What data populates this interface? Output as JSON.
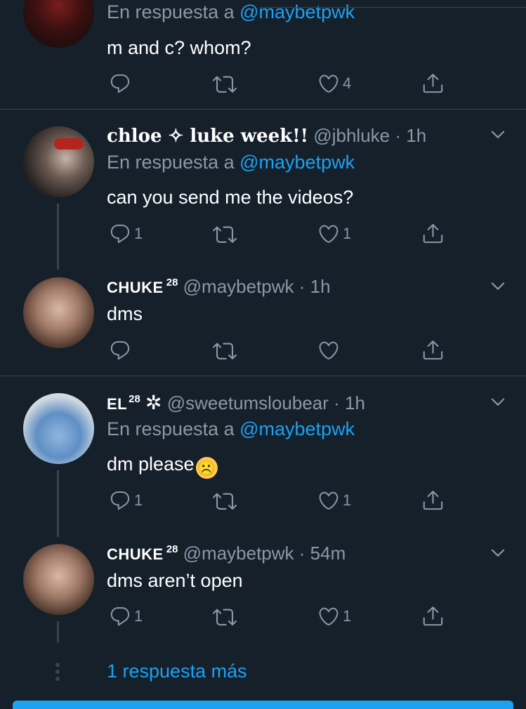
{
  "top_tweet": {
    "reply_prefix": "En respuesta a ",
    "reply_handle": "@maybetpwk",
    "text": "m and c? whom?",
    "like_count": "4"
  },
  "tweet1": {
    "display_name": "chloe ✧ luke week!!",
    "handle": "@jbhluke",
    "time": "· 1h",
    "reply_prefix": "En respuesta a ",
    "reply_handle": "@maybetpwk",
    "text": "can you send me the videos?",
    "reply_count": "1",
    "like_count": "1"
  },
  "tweet2": {
    "display_name": "CHUKE",
    "superscript": "28",
    "handle": "@maybetpwk",
    "time": "· 1h",
    "text": "dms"
  },
  "tweet3": {
    "display_name": "EL",
    "superscript": "28",
    "name_symbol": "✲",
    "handle": "@sweetumsloubear",
    "time": "· 1h",
    "reply_prefix": "En respuesta a ",
    "reply_handle": "@maybetpwk",
    "text": "dm please",
    "emoji": "☹️",
    "reply_count": "1",
    "like_count": "1"
  },
  "tweet4": {
    "display_name": "CHUKE",
    "superscript": "28",
    "handle": "@maybetpwk",
    "time": "· 54m",
    "text": "dms aren’t open",
    "reply_count": "1",
    "like_count": "1"
  },
  "more_replies": "1 respuesta más",
  "colors": {
    "background": "#15202b",
    "link": "#1da1f2",
    "secondary": "#8899a6",
    "divider": "#38444d"
  }
}
